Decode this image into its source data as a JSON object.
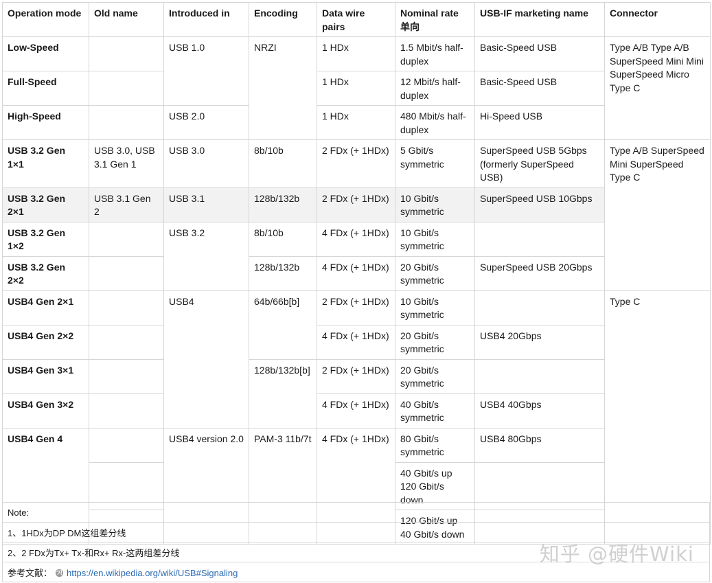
{
  "headers": {
    "mode": "Operation mode",
    "old_name": "Old name",
    "introduced": "Introduced in",
    "encoding": "Encoding",
    "pairs": "Data wire pairs",
    "rate": "Nominal rate\n单向",
    "marketing": "USB-IF marketing name",
    "connector": "Connector"
  },
  "rows": [
    {
      "mode": "Low-Speed",
      "old": "",
      "intro": "USB 1.0",
      "enc": "NRZI",
      "pairs": "1 HDx",
      "rate": "1.5 Mbit/s\nhalf-duplex",
      "mkt": "Basic-Speed USB",
      "conn": "Type A/B\nType A/B SuperSpeed\nMini\nMini SuperSpeed\nMicro\nType C"
    },
    {
      "mode": "Full-Speed",
      "old": "",
      "pairs": "1 HDx",
      "rate": "12 Mbit/s\nhalf-duplex",
      "mkt": "Basic-Speed USB"
    },
    {
      "mode": "High-Speed",
      "old": "",
      "intro": "USB 2.0",
      "pairs": "1 HDx",
      "rate": "480 Mbit/s\nhalf-duplex",
      "mkt": "Hi-Speed USB"
    },
    {
      "mode": "USB 3.2 Gen 1×1",
      "old": "USB 3.0,\nUSB 3.1 Gen 1",
      "intro": "USB 3.0",
      "enc": "8b/10b",
      "pairs": "2 FDx (+ 1HDx)",
      "rate": "5 Gbit/s\nsymmetric",
      "mkt": "SuperSpeed USB 5Gbps\n(formerly SuperSpeed USB)",
      "conn": "Type A/B SuperSpeed\nMini SuperSpeed\nType C"
    },
    {
      "mode": "USB 3.2 Gen 2×1",
      "old": "USB 3.1 Gen 2",
      "intro": "USB 3.1",
      "enc": "128b/132b",
      "pairs": "2 FDx (+ 1HDx)",
      "rate": "10 Gbit/s\nsymmetric",
      "mkt": "SuperSpeed USB 10Gbps"
    },
    {
      "mode": "USB 3.2 Gen 1×2",
      "old": "",
      "intro": "USB 3.2",
      "enc": "8b/10b",
      "pairs": "4 FDx (+ 1HDx)",
      "rate": "10 Gbit/s\nsymmetric",
      "mkt": ""
    },
    {
      "mode": "USB 3.2 Gen 2×2",
      "old": "",
      "enc": "128b/132b",
      "pairs": "4 FDx (+ 1HDx)",
      "rate": "20 Gbit/s\nsymmetric",
      "mkt": "SuperSpeed USB 20Gbps"
    },
    {
      "mode": "USB4 Gen 2×1",
      "old": "",
      "intro": "USB4",
      "enc": "64b/66b[b]",
      "pairs": "2 FDx (+ 1HDx)",
      "rate": "10 Gbit/s\nsymmetric",
      "mkt": "",
      "conn": "Type C"
    },
    {
      "mode": "USB4 Gen 2×2",
      "old": "",
      "pairs": "4 FDx (+ 1HDx)",
      "rate": "20 Gbit/s\nsymmetric",
      "mkt": "USB4 20Gbps"
    },
    {
      "mode": "USB4 Gen 3×1",
      "old": "",
      "enc": "128b/132b[b]",
      "pairs": "2 FDx (+ 1HDx)",
      "rate": "20 Gbit/s\nsymmetric",
      "mkt": ""
    },
    {
      "mode": "USB4 Gen 3×2",
      "old": "",
      "pairs": "4 FDx (+ 1HDx)",
      "rate": "40 Gbit/s\nsymmetric",
      "mkt": "USB4 40Gbps"
    },
    {
      "mode": "USB4 Gen 4",
      "old": "",
      "intro": "USB4 version 2.0",
      "enc": "PAM-3 11b/7t",
      "pairs": "4 FDx (+ 1HDx)",
      "rate": "80 Gbit/s\nsymmetric",
      "mkt": "USB4 80Gbps"
    },
    {
      "old": "",
      "rate": "40 Gbit/s up\n120 Gbit/s down",
      "mkt": ""
    },
    {
      "old": "",
      "rate": "120 Gbit/s up\n40 Gbit/s down",
      "mkt": ""
    }
  ],
  "notes": {
    "label": "Note:",
    "line1": "1、1HDx为DP DM这组差分线",
    "line2": "2、2 FDx为Tx+ Tx-和Rx+ Rx-这两组差分线",
    "ref_label": "参考文献：",
    "ref_url": "https://en.wikipedia.org/wiki/USB#Signaling"
  },
  "watermark": "知乎 @硬件Wiki",
  "colors": {
    "link": "#2a6ab3",
    "border": "#d6d6d6",
    "highlight_row": "#f2f2f2"
  }
}
